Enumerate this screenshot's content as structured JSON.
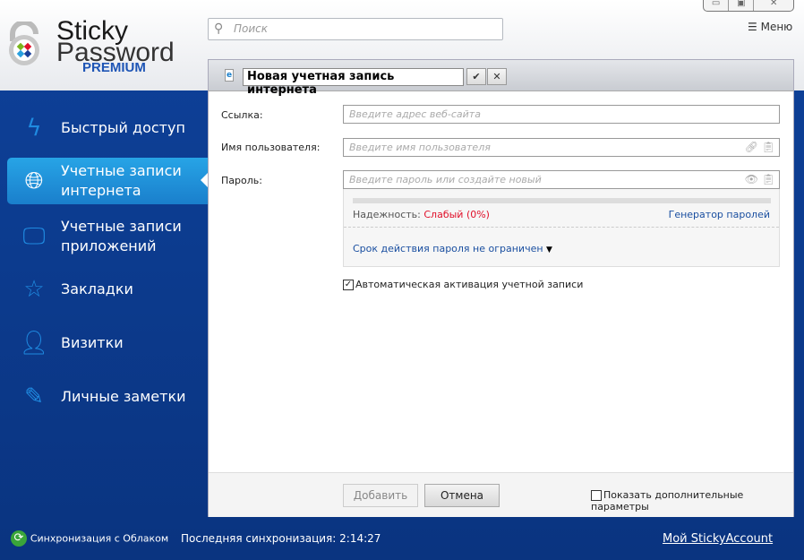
{
  "logo": {
    "line1": "Sticky",
    "line2": "Password",
    "line3": "PREMIUM"
  },
  "search": {
    "placeholder": "Поиск"
  },
  "menu_label": "Меню",
  "sidebar": {
    "items": [
      {
        "label": "Быстрый доступ",
        "icon": "lightning-icon"
      },
      {
        "label": "Учетные записи интернета",
        "icon": "globe-icon"
      },
      {
        "label": "Учетные записи приложений",
        "icon": "monitor-icon"
      },
      {
        "label": "Закладки",
        "icon": "star-icon"
      },
      {
        "label": "Визитки",
        "icon": "person-icon"
      },
      {
        "label": "Личные заметки",
        "icon": "note-icon"
      }
    ]
  },
  "panel": {
    "title": "Новая учетная запись интернета",
    "url_label": "Ссылка:",
    "url_placeholder": "Введите адрес веб-сайта",
    "user_label": "Имя пользователя:",
    "user_placeholder": "Введите имя пользователя",
    "pass_label": "Пароль:",
    "pass_placeholder": "Введите пароль или создайте новый",
    "strength_label": "Надежность:",
    "strength_value": "Слабый (0%)",
    "strength_percent": 0,
    "generator": "Генератор паролей",
    "expiry": "Срок действия пароля не ограничен",
    "auto_activate": "Автоматическая активация учетной записи",
    "add": "Добавить",
    "cancel": "Отмена",
    "show_more": "Показать дополнительные параметры"
  },
  "status": {
    "sync": "Синхронизация с Облаком",
    "last_sync": "Последняя синхронизация: 2:14:27",
    "account": "Мой StickyAccount"
  },
  "colors": {
    "accent": "#1a7fcc",
    "weak": "#e0102a",
    "link": "#1a4fa0"
  }
}
